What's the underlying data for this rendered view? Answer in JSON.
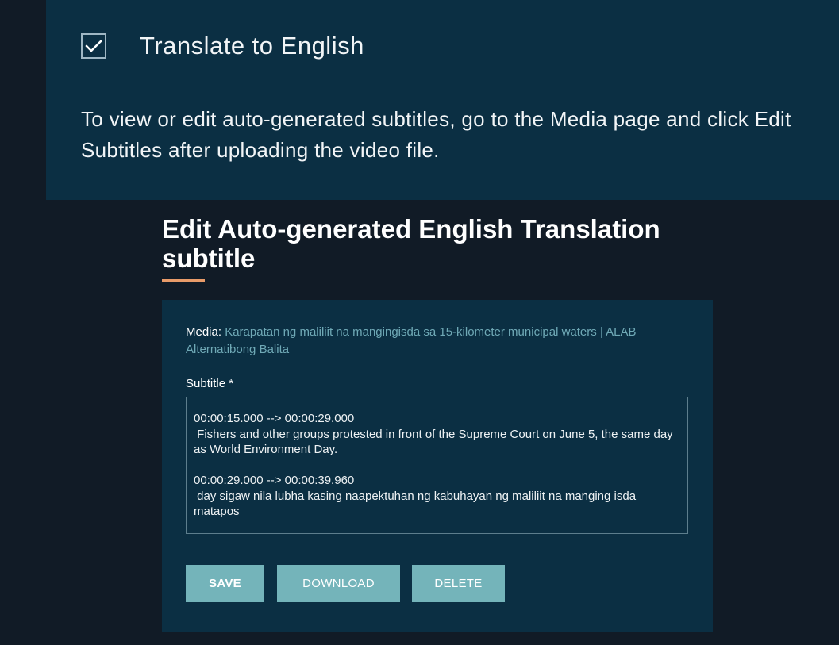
{
  "translate": {
    "checked": true,
    "label": "Translate to English",
    "help_text": "To view or edit auto-generated subtitles, go to the Media page and click Edit Subtitles after uploading the video file."
  },
  "section": {
    "title": "Edit Auto-generated English Translation subtitle"
  },
  "form": {
    "media_label": "Media:",
    "media_value": "Karapatan ng maliliit na mangingisda sa 15-kilometer municipal waters | ALAB Alternatibong Balita",
    "subtitle_label": "Subtitle *",
    "subtitle_text": "00:00:15.000 --> 00:00:29.000\n Fishers and other groups protested in front of the Supreme Court on June 5, the same day as World Environment Day.\n\n00:00:29.000 --> 00:00:39.960\n day sigaw nila lubha kasing naapektuhan ng kabuhayan ng maliliit na manging isda matapos",
    "buttons": {
      "save": "SAVE",
      "download": "DOWNLOAD",
      "delete": "DELETE"
    }
  },
  "colors": {
    "page_background": "#111b26",
    "panel_background": "#0b2f43",
    "accent_underline": "#e89b69",
    "button_background": "#74b4ba",
    "link_text": "#6fa9b6"
  },
  "icons": {
    "checkbox": "checkmark-icon"
  }
}
